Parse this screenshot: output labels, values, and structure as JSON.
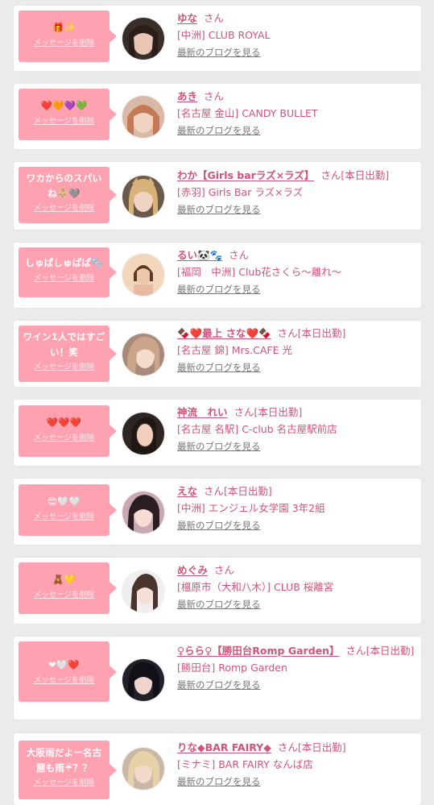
{
  "delete_label": "メッセージを削除",
  "blog_label": "最新のブログを見る",
  "honorific": "さん",
  "today_label": "[本日出勤]",
  "colors": {
    "bubble": "#fea2b2",
    "accent": "#d0547a",
    "background": "#ebebeb"
  },
  "items": [
    {
      "message": "🎁✨",
      "name": "ゆな",
      "today": "",
      "shop": "[中洲] CLUB ROYAL"
    },
    {
      "message": "❤️🧡💜💚",
      "name": "あき",
      "today": "",
      "shop": "[名古屋 金山] CANDY BULLET"
    },
    {
      "message": "ワカからのスパいね👶🏼🩶",
      "name": "わか【Girls barラズ×ラズ】",
      "today": "[本日出勤]",
      "shop": "[赤羽] Girls Bar ラズ×ラズ"
    },
    {
      "message": "しゅぱしゅぱぱ🫧",
      "name": "るい🐼🐾",
      "today": "",
      "shop": "[福岡　中洲] Club花さくら～離れ～"
    },
    {
      "message": "ワイン1人ではすごい！笑",
      "name": "🍫❤️最上 さな❤️🍫",
      "today": "[本日出勤]",
      "shop": "[名古屋 錦] Mrs.CAFE 光"
    },
    {
      "message": "❤️❤️❤️",
      "name": "神流　れい",
      "today": "[本日出勤]",
      "shop": "[名古屋 名駅] C-club 名古屋駅前店"
    },
    {
      "message": "😍🤍🤍",
      "name": "えな",
      "today": "[本日出勤]",
      "shop": "[中洲] エンジェル女学園 3年2組"
    },
    {
      "message": "🧸💛",
      "name": "めぐみ",
      "today": "",
      "shop": "[橿原市（大和八木）] CLUB 桜離宮"
    },
    {
      "message": "❤🤍❤️",
      "name": "♀らら♀【勝田台Romp Garden】",
      "today": "[本日出勤]",
      "shop": "[勝田台] Romp Garden"
    },
    {
      "message": "大阪雨だよー名古屋も雨☔？？",
      "name": "りな◆BAR FAIRY◆",
      "today": "[本日出勤]",
      "shop": "[ミナミ] BAR FAIRY なんば店"
    }
  ]
}
